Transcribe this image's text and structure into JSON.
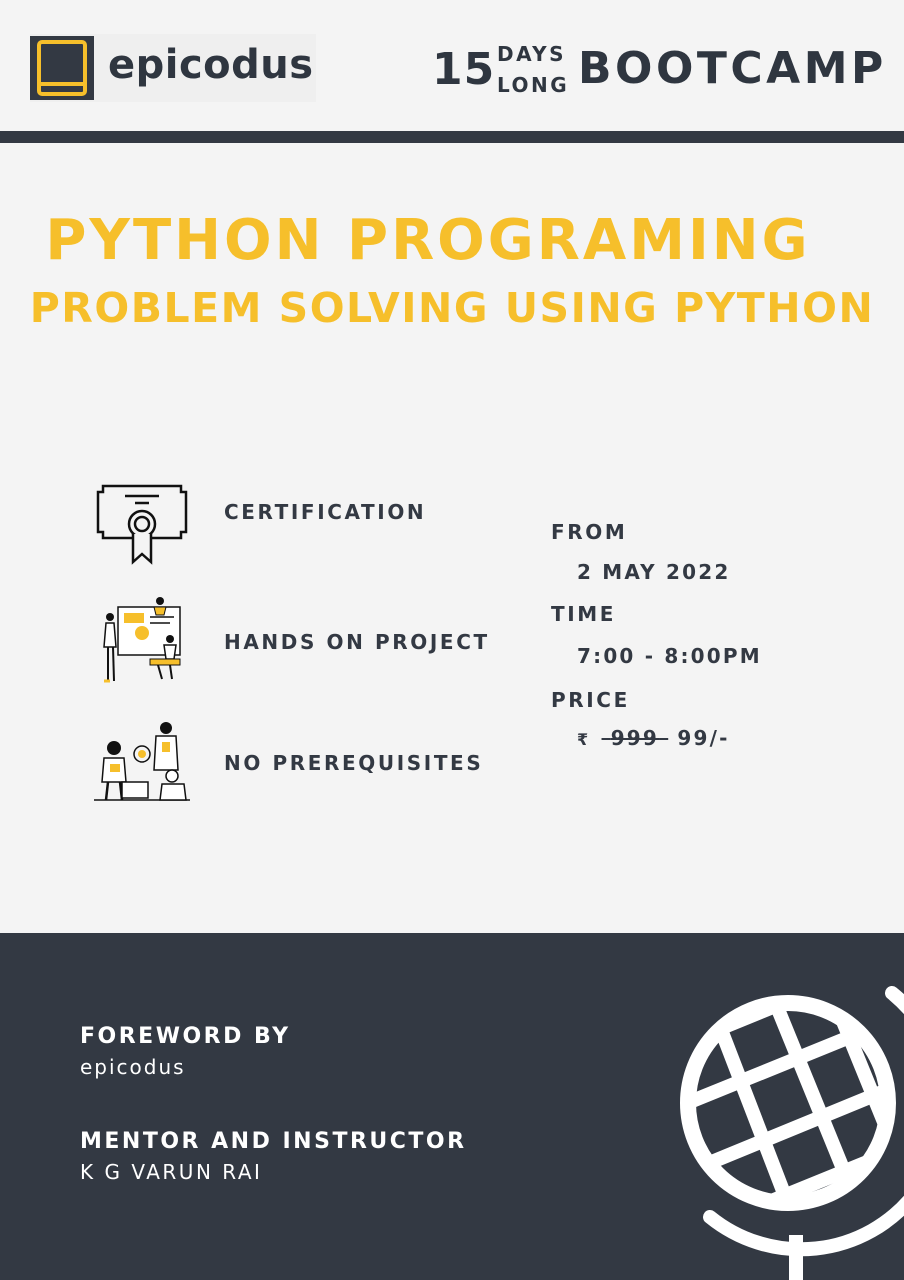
{
  "header": {
    "logo_text": "epicodus",
    "days_number": "15",
    "days_word": "DAYS",
    "long_word": "LONG",
    "bootcamp": "BOOTCAMP"
  },
  "titles": {
    "main": "PYTHON PROGRAMING",
    "sub": "PROBLEM SOLVING USING PYTHON"
  },
  "features": [
    {
      "label": "CERTIFICATION",
      "icon": "certificate-icon"
    },
    {
      "label": "HANDS ON PROJECT",
      "icon": "project-illustration"
    },
    {
      "label": "NO PREREQUISITES",
      "icon": "team-illustration"
    }
  ],
  "schedule": {
    "from_label": "FROM",
    "from_value": "2 MAY 2022",
    "time_label": "TIME",
    "time_value": "7:00 - 8:00PM",
    "price_label": "PRICE",
    "currency": "₹",
    "old_price": "999",
    "new_price": "99/-"
  },
  "footer": {
    "foreword_label": "FOREWORD BY",
    "foreword_value": "epicodus",
    "mentor_label": "MENTOR AND INSTRUCTOR",
    "mentor_value": "K G VARUN RAI",
    "globe_icon": "globe-icon"
  },
  "colors": {
    "accent": "#f6bf2b",
    "dark": "#333943",
    "background": "#f4f4f4"
  }
}
